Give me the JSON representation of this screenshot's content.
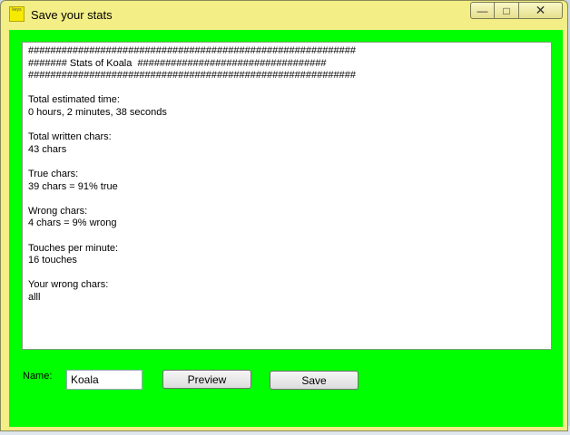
{
  "window": {
    "title": "Save your stats",
    "icon": "app-logo-icon",
    "icon_text": "keys",
    "controls": {
      "minimize": "—",
      "maximize": "□",
      "close": "✕"
    },
    "frame_color": "#f3ee86",
    "client_color": "#00ff00"
  },
  "stats": {
    "lines": [
      "###########################################################",
      "####### Stats of Koala  ##################################",
      "###########################################################",
      "",
      "Total estimated time:",
      "0 hours, 2 minutes, 38 seconds",
      "",
      "Total written chars:",
      "43 chars",
      "",
      "True chars:",
      "39 chars = 91% true",
      "",
      "Wrong chars:",
      "4 chars = 9% wrong",
      "",
      "Touches per minute:",
      "16 touches",
      "",
      "Your wrong chars:",
      "alll"
    ]
  },
  "form": {
    "name_label": "Name:",
    "name_value": "Koala",
    "preview_label": "Preview",
    "save_label": "Save"
  }
}
